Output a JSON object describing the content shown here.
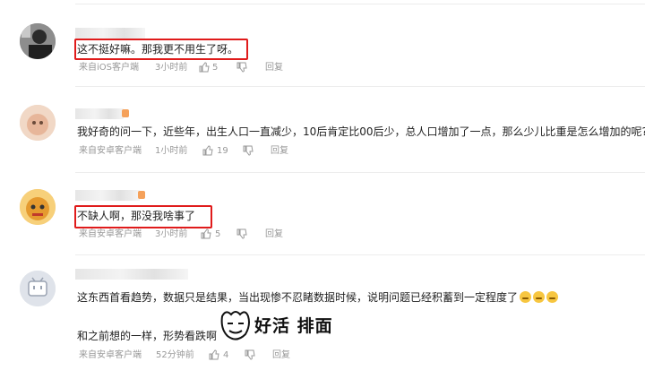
{
  "comments": [
    {
      "text": "这不挺好嘛。那我更不用生了呀。",
      "source": "来自iOS客户端",
      "time": "3小时前",
      "likes": "5",
      "reply": "回复"
    },
    {
      "text": "我好奇的问一下，近些年，出生人口一直减少，10后肯定比00后少，总人口增加了一点，那么少儿比重是怎么增加的呢?",
      "source": "来自安卓客户端",
      "time": "1小时前",
      "likes": "19",
      "reply": "回复"
    },
    {
      "text": "不缺人啊，那没我啥事了",
      "source": "来自安卓客户端",
      "time": "3小时前",
      "likes": "5",
      "reply": "回复"
    },
    {
      "text": "这东西首看趋势，数据只是结果，当出现惨不忍睹数据时候，说明问题已经积蓄到一定程度了",
      "text2": "和之前想的一样，形势看跌啊",
      "source": "来自安卓客户端",
      "time": "52分钟前",
      "likes": "4",
      "reply": "回复"
    }
  ],
  "watermark": "好活 排面",
  "icons": {
    "like": "thumbs-up-icon",
    "dislike": "thumbs-down-icon"
  }
}
